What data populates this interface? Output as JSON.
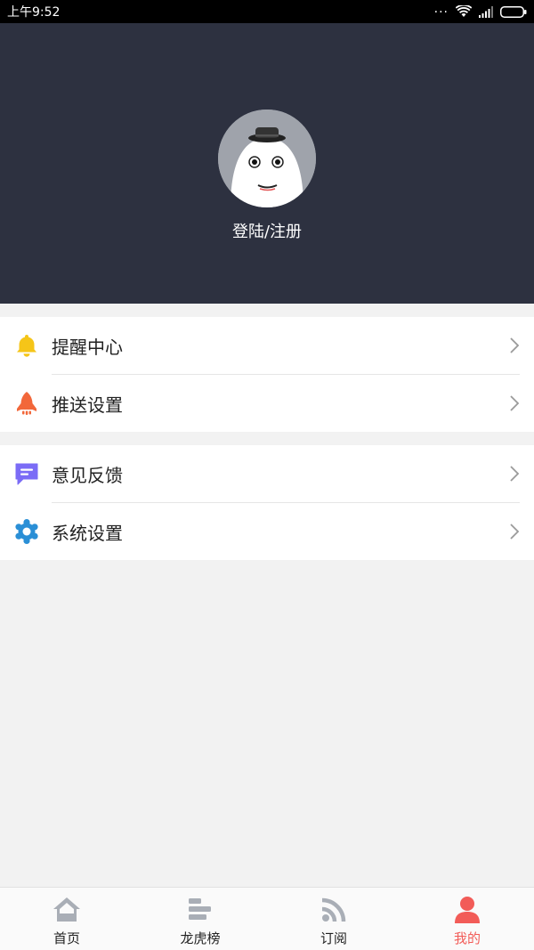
{
  "statusbar": {
    "time": "上午9:52",
    "more": "..."
  },
  "profile": {
    "login_label": "登陆/注册"
  },
  "menu": {
    "group1": [
      {
        "label": "提醒中心",
        "icon": "bell-icon",
        "color": "#f5c518"
      },
      {
        "label": "推送设置",
        "icon": "rocket-icon",
        "color": "#f2673a"
      }
    ],
    "group2": [
      {
        "label": "意见反馈",
        "icon": "feedback-icon",
        "color": "#7b6cf6"
      },
      {
        "label": "系统设置",
        "icon": "gear-icon",
        "color": "#2a8fd6"
      }
    ]
  },
  "tabs": [
    {
      "label": "首页",
      "icon": "home-icon"
    },
    {
      "label": "龙虎榜",
      "icon": "ranking-icon"
    },
    {
      "label": "订阅",
      "icon": "rss-icon"
    },
    {
      "label": "我的",
      "icon": "user-icon",
      "active": true
    }
  ],
  "colors": {
    "header_bg": "#2d3140",
    "accent": "#f25c58",
    "tab_inactive": "#a9aeb6"
  }
}
